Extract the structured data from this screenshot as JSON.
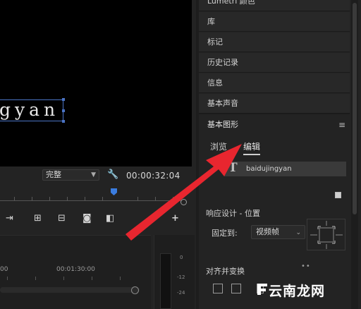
{
  "panel_list": {
    "items": [
      {
        "label": "Lumetri 颜色"
      },
      {
        "label": "库"
      },
      {
        "label": "标记"
      },
      {
        "label": "历史记录"
      },
      {
        "label": "信息"
      },
      {
        "label": "基本声音"
      }
    ]
  },
  "essential_graphics": {
    "title": "基本图形",
    "menu_icon": "≡",
    "tabs": [
      {
        "label": "浏览",
        "active": false
      },
      {
        "label": "编辑",
        "active": true
      }
    ],
    "layer_icon": "T",
    "layer_name": "baidujingyan",
    "responsive_design_label": "响应设计 - 位置",
    "pin_to_label": "固定到:",
    "pin_to_value": "视频帧",
    "align_transform_label": "对齐并变换"
  },
  "monitor": {
    "title_text": "gyan",
    "fit_value": "完整",
    "timecode": "00:00:32:04",
    "icons": [
      "wrench-icon",
      "step-forward-icon",
      "lift-icon",
      "extract-icon",
      "camera-icon",
      "compare-icon",
      "add-icon"
    ]
  },
  "timeline": {
    "time_labels": [
      "00",
      "00:01:30:00"
    ]
  },
  "audio_meter": {
    "labels": [
      "0",
      "-12",
      "-24"
    ]
  },
  "annotation": {
    "arrow_color": "#e8262f"
  },
  "watermark": {
    "text": "云南龙网"
  },
  "colors": {
    "accent_blue": "#3b7de0",
    "selection_box": "#4a73c4",
    "panel_bg": "#282828"
  }
}
